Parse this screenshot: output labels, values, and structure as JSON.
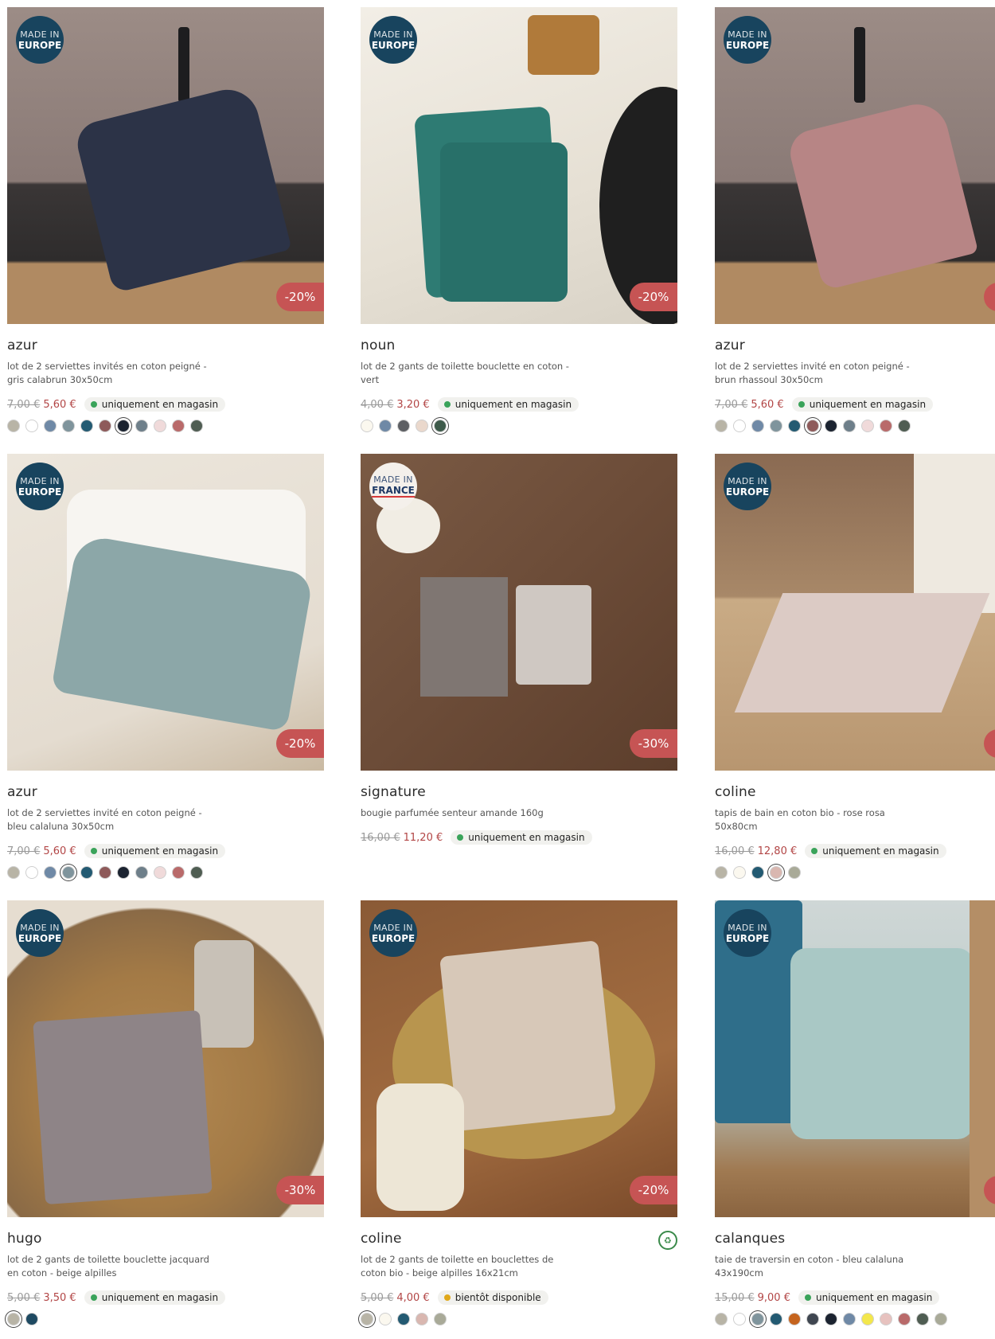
{
  "products": [
    {
      "brand": "azur",
      "desc": "lot de 2 serviettes invités en coton peigné - gris calabrun 30x50cm",
      "old": "7,00 €",
      "price": "5,60 €",
      "stock": "uniquement en magasin",
      "stock_color": "#3aa35a",
      "made": "MADE IN",
      "origin": "EUROPE",
      "discount": "-20%",
      "swatches": [
        "#b8b4a6",
        "#ffffff",
        "#6f89a6",
        "#7f949c",
        "#235a72",
        "#8e5a5a",
        "#1b2330",
        "#6e7f8a",
        "#f0dada",
        "#b96a6a",
        "#4f5d52"
      ],
      "selected": 6
    },
    {
      "brand": "noun",
      "desc": "lot de 2 gants de toilette bouclette en coton - vert",
      "old": "4,00 €",
      "price": "3,20 €",
      "stock": "uniquement en magasin",
      "stock_color": "#3aa35a",
      "made": "MADE IN",
      "origin": "EUROPE",
      "discount": "-20%",
      "swatches": [
        "#fbf8ef",
        "#6f89a6",
        "#5d5f63",
        "#ead8cc",
        "#3d5a4a"
      ],
      "selected": 4
    },
    {
      "brand": "azur",
      "desc": "lot de 2 serviettes invité en coton peigné - brun rhassoul 30x50cm",
      "old": "7,00 €",
      "price": "5,60 €",
      "stock": "uniquement en magasin",
      "stock_color": "#3aa35a",
      "made": "MADE IN",
      "origin": "EUROPE",
      "discount": "",
      "swatches": [
        "#b8b4a6",
        "#ffffff",
        "#6f89a6",
        "#7f949c",
        "#235a72",
        "#8e5a5a",
        "#1b2330",
        "#6e7f8a",
        "#f0dada",
        "#b96a6a",
        "#4f5d52"
      ],
      "selected": 5
    },
    {
      "brand": "azur",
      "desc": "lot de 2 serviettes invité en coton peigné - bleu calaluna 30x50cm",
      "old": "7,00 €",
      "price": "5,60 €",
      "stock": "uniquement en magasin",
      "stock_color": "#3aa35a",
      "made": "MADE IN",
      "origin": "EUROPE",
      "discount": "-20%",
      "swatches": [
        "#b8b4a6",
        "#ffffff",
        "#6f89a6",
        "#7f949c",
        "#235a72",
        "#8e5a5a",
        "#1b2330",
        "#6e7f8a",
        "#f0dada",
        "#b96a6a",
        "#4f5d52"
      ],
      "selected": 3
    },
    {
      "brand": "signature",
      "desc": "bougie parfumée senteur amande 160g",
      "old": "16,00 €",
      "price": "11,20 €",
      "stock": "uniquement en magasin",
      "stock_color": "#3aa35a",
      "made": "MADE IN",
      "origin": "FRANCE",
      "discount": "-30%",
      "swatches": [],
      "selected": -1
    },
    {
      "brand": "coline",
      "desc": "tapis de bain en coton bio - rose rosa 50x80cm",
      "old": "16,00 €",
      "price": "12,80 €",
      "stock": "uniquement en magasin",
      "stock_color": "#3aa35a",
      "made": "MADE IN",
      "origin": "EUROPE",
      "discount": "",
      "swatches": [
        "#b8b4a6",
        "#fbf8ef",
        "#235a72",
        "#d9b7b0",
        "#a9aa98"
      ],
      "selected": 3
    },
    {
      "brand": "hugo",
      "desc": "lot de 2 gants de toilette bouclette jacquard en coton - beige alpilles",
      "old": "5,00 €",
      "price": "3,50 €",
      "stock": "uniquement en magasin",
      "stock_color": "#3aa35a",
      "made": "MADE IN",
      "origin": "EUROPE",
      "discount": "-30%",
      "swatches": [
        "#b8b4a6",
        "#1e4a62"
      ],
      "selected": 0
    },
    {
      "brand": "coline",
      "desc": "lot de 2 gants de toilette en bouclettes de coton bio - beige alpilles 16x21cm",
      "old": "5,00 €",
      "price": "4,00 €",
      "stock": "bientôt disponible",
      "stock_color": "#e0a81a",
      "made": "MADE IN",
      "origin": "EUROPE",
      "discount": "-20%",
      "swatches": [
        "#b8b4a6",
        "#fbf8ef",
        "#235a72",
        "#d9b7b0",
        "#a9aa98"
      ],
      "selected": 0
    },
    {
      "brand": "calanques",
      "desc": "taie de traversin en coton - bleu calaluna 43x190cm",
      "old": "15,00 €",
      "price": "9,00 €",
      "stock": "uniquement en magasin",
      "stock_color": "#3aa35a",
      "made": "MADE IN",
      "origin": "EUROPE",
      "discount": "",
      "swatches": [
        "#b8b4a6",
        "#ffffff",
        "#7f949c",
        "#235a72",
        "#c5641e",
        "#3f4650",
        "#1b2330",
        "#6f89a6",
        "#f3e74c",
        "#e7c2bf",
        "#b96a6a",
        "#4f5d52",
        "#a9aa98"
      ],
      "selected": 2
    }
  ],
  "colors": {
    "made_badge": "#18445e",
    "discount": "#c65454",
    "sale_price": "#b24545"
  },
  "icons": {
    "bio": "organic-cotton-icon"
  }
}
